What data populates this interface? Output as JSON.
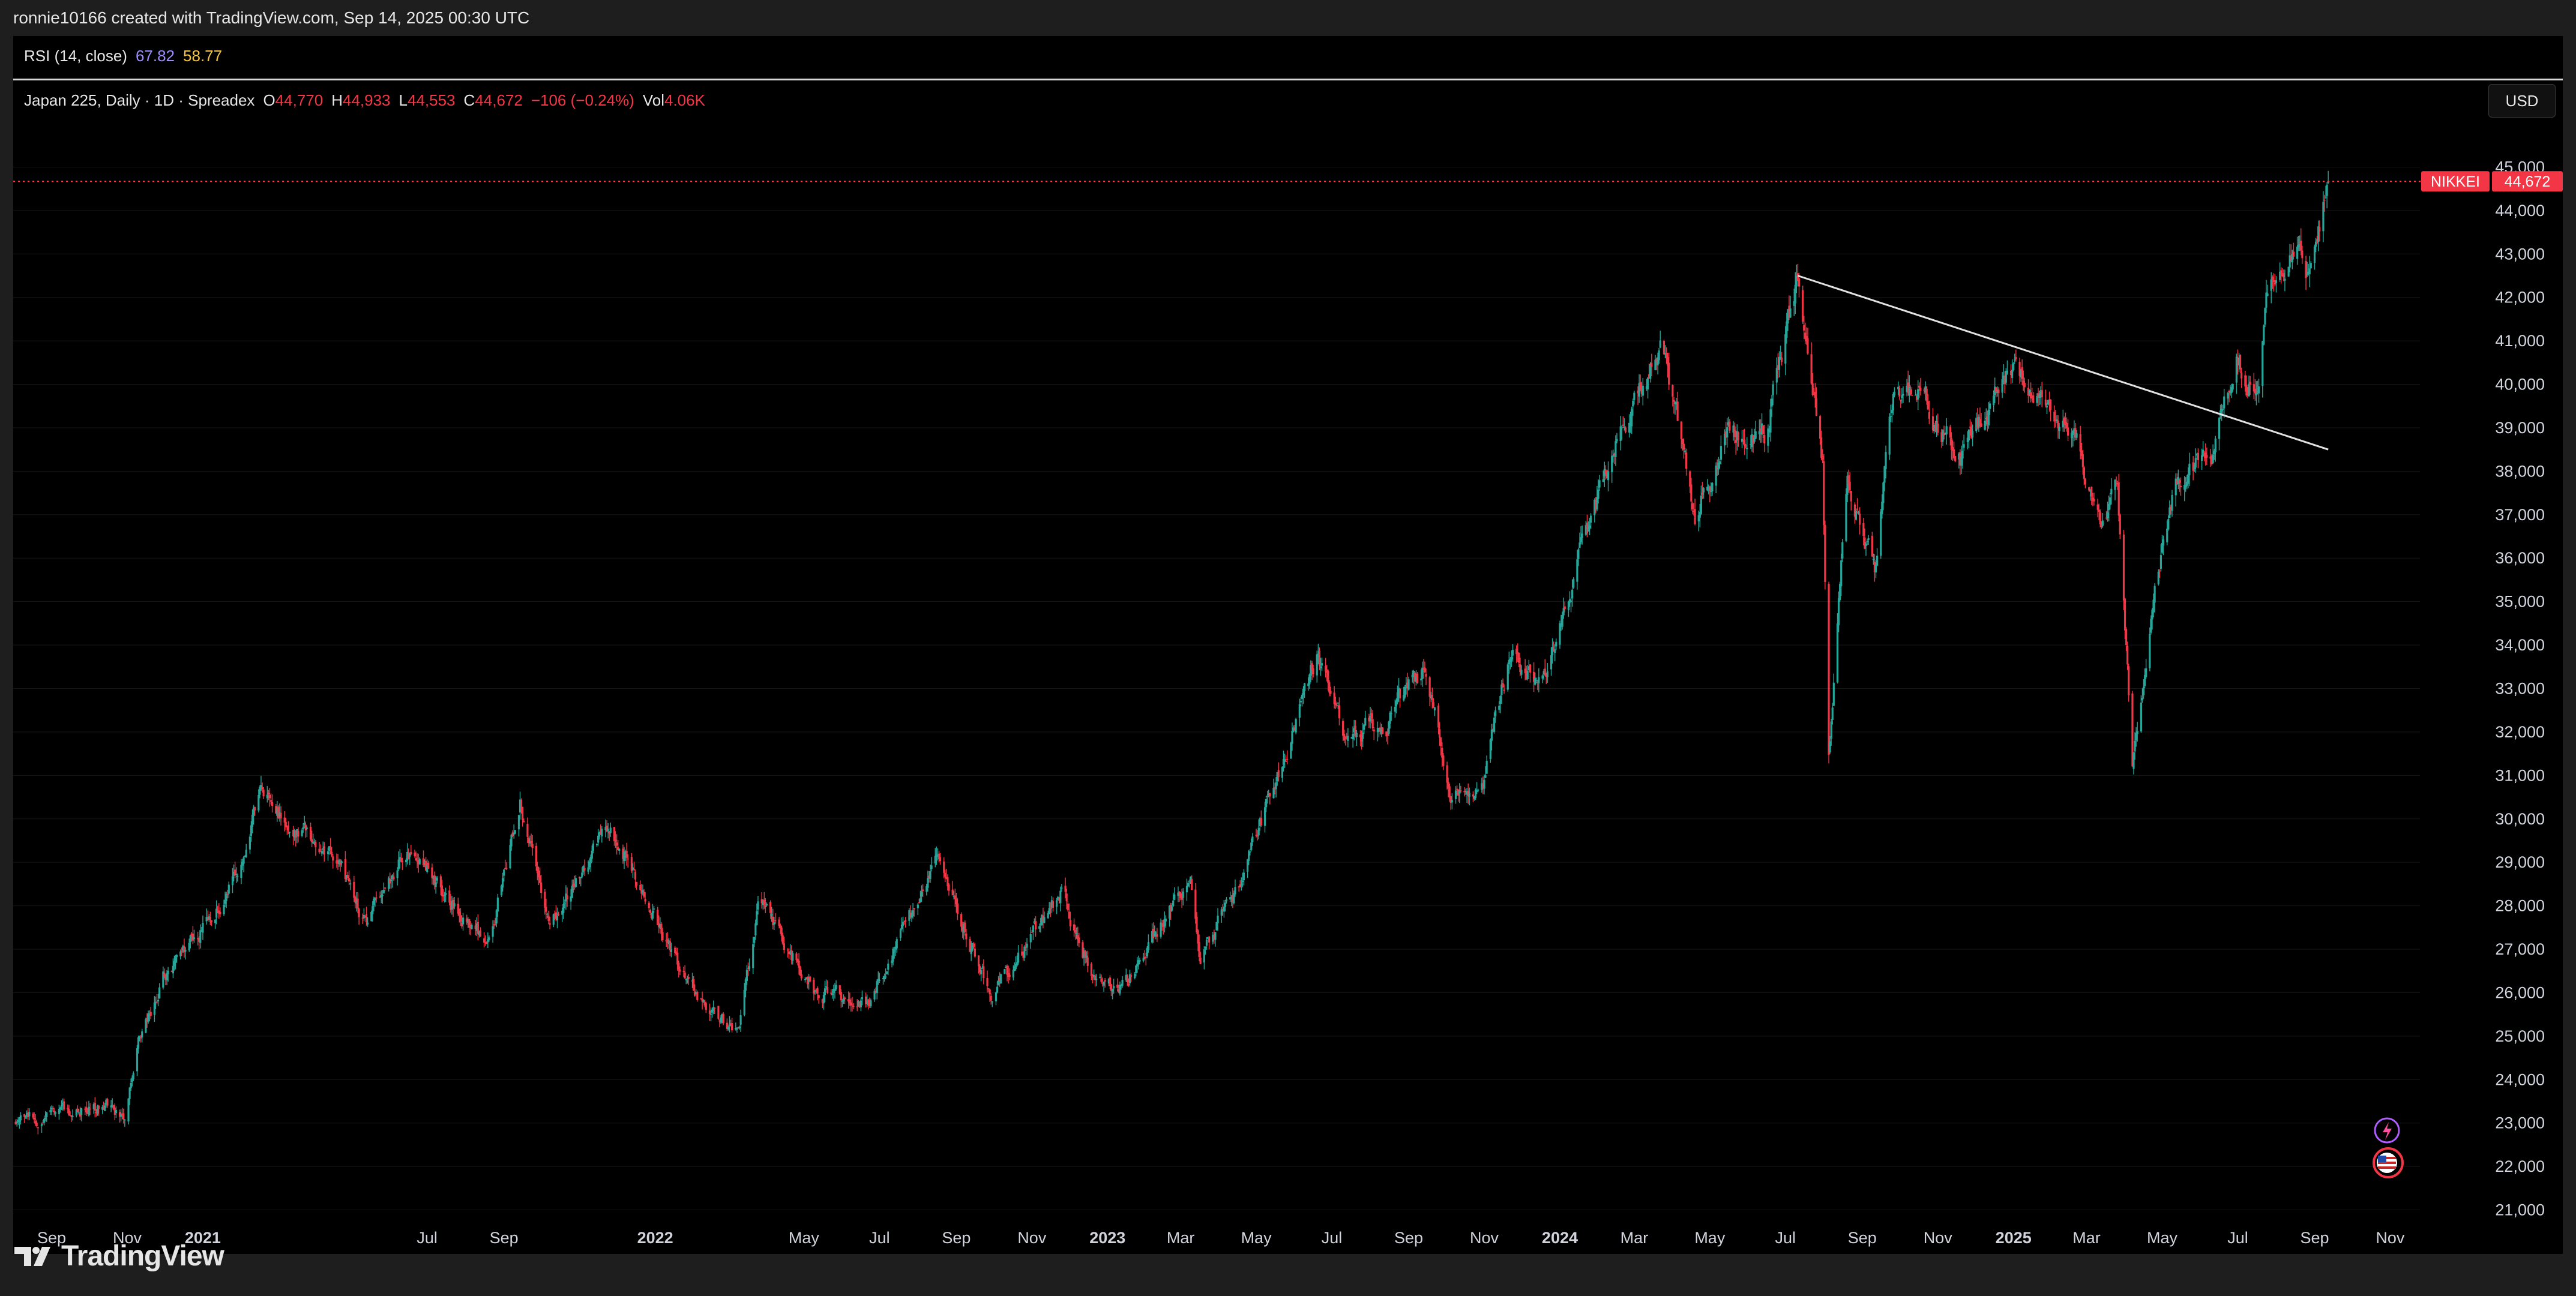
{
  "credit": "ronnie10166 created with TradingView.com, Sep 14, 2025 00:30 UTC",
  "rsi": {
    "label": "RSI (14, close)",
    "value1": "67.82",
    "value2": "58.77"
  },
  "legend": {
    "symbol": "Japan 225, Daily · 1D · Spreadex",
    "open_label": "O",
    "open": "44,770",
    "high_label": "H",
    "high": "44,933",
    "low_label": "L",
    "low": "44,553",
    "close_label": "C",
    "close": "44,672",
    "change": "−106 (−0.24%)",
    "vol_label": "Vol",
    "vol": "4.06K"
  },
  "currency_button": "USD",
  "price_tag": {
    "name": "NIKKEI",
    "value": "44,672",
    "price": 44672
  },
  "logo": "TradingView",
  "colors": {
    "up": "#26a69a",
    "down": "#f23645",
    "background": "#000000",
    "frame": "#1e1e1e",
    "grid": "#161616",
    "trendline": "#e0e0e0",
    "tag": "#f23645"
  },
  "chart_data": {
    "type": "candlestick",
    "series_name": "Japan 225",
    "ylim": [
      20400,
      45600
    ],
    "y_ticks": [
      {
        "label": "45,000",
        "value": 45000
      },
      {
        "label": "44,000",
        "value": 44000
      },
      {
        "label": "43,000",
        "value": 43000
      },
      {
        "label": "42,000",
        "value": 42000
      },
      {
        "label": "41,000",
        "value": 41000
      },
      {
        "label": "40,000",
        "value": 40000
      },
      {
        "label": "39,000",
        "value": 39000
      },
      {
        "label": "38,000",
        "value": 38000
      },
      {
        "label": "37,000",
        "value": 37000
      },
      {
        "label": "36,000",
        "value": 36000
      },
      {
        "label": "35,000",
        "value": 35000
      },
      {
        "label": "34,000",
        "value": 34000
      },
      {
        "label": "33,000",
        "value": 33000
      },
      {
        "label": "32,000",
        "value": 32000
      },
      {
        "label": "31,000",
        "value": 31000
      },
      {
        "label": "30,000",
        "value": 30000
      },
      {
        "label": "29,000",
        "value": 29000
      },
      {
        "label": "28,000",
        "value": 28000
      },
      {
        "label": "27,000",
        "value": 27000
      },
      {
        "label": "26,000",
        "value": 26000
      },
      {
        "label": "25,000",
        "value": 25000
      },
      {
        "label": "24,000",
        "value": 24000
      },
      {
        "label": "23,000",
        "value": 23000
      },
      {
        "label": "22,000",
        "value": 22000
      },
      {
        "label": "21,000",
        "value": 21000
      }
    ],
    "x_ticks": [
      {
        "label": "Sep",
        "date": "2020-09-01",
        "bold": false
      },
      {
        "label": "Nov",
        "date": "2020-11-01",
        "bold": false
      },
      {
        "label": "2021",
        "date": "2021-01-01",
        "bold": true
      },
      {
        "label": "Jul",
        "date": "2021-07-01",
        "bold": false
      },
      {
        "label": "Sep",
        "date": "2021-09-01",
        "bold": false
      },
      {
        "label": "2022",
        "date": "2022-01-01",
        "bold": true
      },
      {
        "label": "May",
        "date": "2022-05-01",
        "bold": false
      },
      {
        "label": "Jul",
        "date": "2022-07-01",
        "bold": false
      },
      {
        "label": "Sep",
        "date": "2022-09-01",
        "bold": false
      },
      {
        "label": "Nov",
        "date": "2022-11-01",
        "bold": false
      },
      {
        "label": "2023",
        "date": "2023-01-01",
        "bold": true
      },
      {
        "label": "Mar",
        "date": "2023-03-01",
        "bold": false
      },
      {
        "label": "May",
        "date": "2023-05-01",
        "bold": false
      },
      {
        "label": "Jul",
        "date": "2023-07-01",
        "bold": false
      },
      {
        "label": "Sep",
        "date": "2023-09-01",
        "bold": false
      },
      {
        "label": "Nov",
        "date": "2023-11-01",
        "bold": false
      },
      {
        "label": "2024",
        "date": "2024-01-01",
        "bold": true
      },
      {
        "label": "Mar",
        "date": "2024-03-01",
        "bold": false
      },
      {
        "label": "May",
        "date": "2024-05-01",
        "bold": false
      },
      {
        "label": "Jul",
        "date": "2024-07-01",
        "bold": false
      },
      {
        "label": "Sep",
        "date": "2024-09-01",
        "bold": false
      },
      {
        "label": "Nov",
        "date": "2024-11-01",
        "bold": false
      },
      {
        "label": "2025",
        "date": "2025-01-01",
        "bold": true
      },
      {
        "label": "Mar",
        "date": "2025-03-01",
        "bold": false
      },
      {
        "label": "May",
        "date": "2025-05-01",
        "bold": false
      },
      {
        "label": "Jul",
        "date": "2025-07-01",
        "bold": false
      },
      {
        "label": "Sep",
        "date": "2025-09-01",
        "bold": false
      },
      {
        "label": "Nov",
        "date": "2025-11-01",
        "bold": false
      }
    ],
    "last_price": 44672,
    "trendline": {
      "start": {
        "date": "2024-07-11",
        "value": 42500
      },
      "end": {
        "date": "2025-09-12",
        "value": 38500
      }
    },
    "price_path": [
      [
        "2020-08-01",
        23000
      ],
      [
        "2020-09-15",
        23300
      ],
      [
        "2020-10-20",
        23400
      ],
      [
        "2020-10-30",
        22950
      ],
      [
        "2020-11-10",
        25000
      ],
      [
        "2020-11-30",
        26400
      ],
      [
        "2020-12-30",
        27450
      ],
      [
        "2021-01-25",
        28500
      ],
      [
        "2021-02-16",
        30400
      ],
      [
        "2021-03-15",
        29700
      ],
      [
        "2021-04-15",
        29300
      ],
      [
        "2021-05-13",
        27600
      ],
      [
        "2021-06-15",
        29400
      ],
      [
        "2021-07-15",
        28300
      ],
      [
        "2021-08-20",
        27100
      ],
      [
        "2021-09-14",
        30500
      ],
      [
        "2021-10-06",
        27600
      ],
      [
        "2021-11-25",
        29800
      ],
      [
        "2021-12-20",
        28500
      ],
      [
        "2022-01-27",
        26200
      ],
      [
        "2022-03-09",
        25000
      ],
      [
        "2022-03-25",
        28100
      ],
      [
        "2022-05-12",
        26000
      ],
      [
        "2022-06-20",
        25700
      ],
      [
        "2022-08-17",
        29200
      ],
      [
        "2022-09-30",
        25900
      ],
      [
        "2022-11-25",
        28300
      ],
      [
        "2022-12-20",
        26400
      ],
      [
        "2023-01-10",
        25900
      ],
      [
        "2023-02-15",
        27600
      ],
      [
        "2023-03-09",
        28600
      ],
      [
        "2023-03-17",
        26900
      ],
      [
        "2023-04-20",
        28600
      ],
      [
        "2023-05-17",
        30900
      ],
      [
        "2023-06-19",
        33700
      ],
      [
        "2023-07-12",
        31900
      ],
      [
        "2023-08-15",
        32300
      ],
      [
        "2023-09-15",
        33500
      ],
      [
        "2023-10-04",
        30600
      ],
      [
        "2023-10-31",
        30900
      ],
      [
        "2023-11-22",
        33700
      ],
      [
        "2023-12-20",
        33200
      ],
      [
        "2024-01-15",
        35900
      ],
      [
        "2024-02-22",
        39100
      ],
      [
        "2024-03-22",
        40800
      ],
      [
        "2024-04-19",
        37100
      ],
      [
        "2024-05-15",
        38900
      ],
      [
        "2024-06-14",
        38800
      ],
      [
        "2024-07-11",
        42400
      ],
      [
        "2024-07-31",
        38100
      ],
      [
        "2024-08-05",
        31500
      ],
      [
        "2024-08-20",
        38000
      ],
      [
        "2024-09-11",
        35600
      ],
      [
        "2024-09-27",
        39800
      ],
      [
        "2024-10-15",
        39900
      ],
      [
        "2024-11-20",
        38300
      ],
      [
        "2024-12-27",
        40200
      ],
      [
        "2025-01-24",
        39800
      ],
      [
        "2025-02-20",
        38700
      ],
      [
        "2025-03-12",
        36900
      ],
      [
        "2025-03-26",
        37900
      ],
      [
        "2025-04-07",
        31100
      ],
      [
        "2025-04-30",
        36000
      ],
      [
        "2025-05-14",
        37900
      ],
      [
        "2025-06-11",
        38300
      ],
      [
        "2025-06-30",
        40500
      ],
      [
        "2025-07-15",
        39700
      ],
      [
        "2025-07-24",
        41800
      ],
      [
        "2025-08-18",
        43700
      ],
      [
        "2025-08-29",
        42500
      ],
      [
        "2025-09-12",
        44700
      ]
    ]
  }
}
